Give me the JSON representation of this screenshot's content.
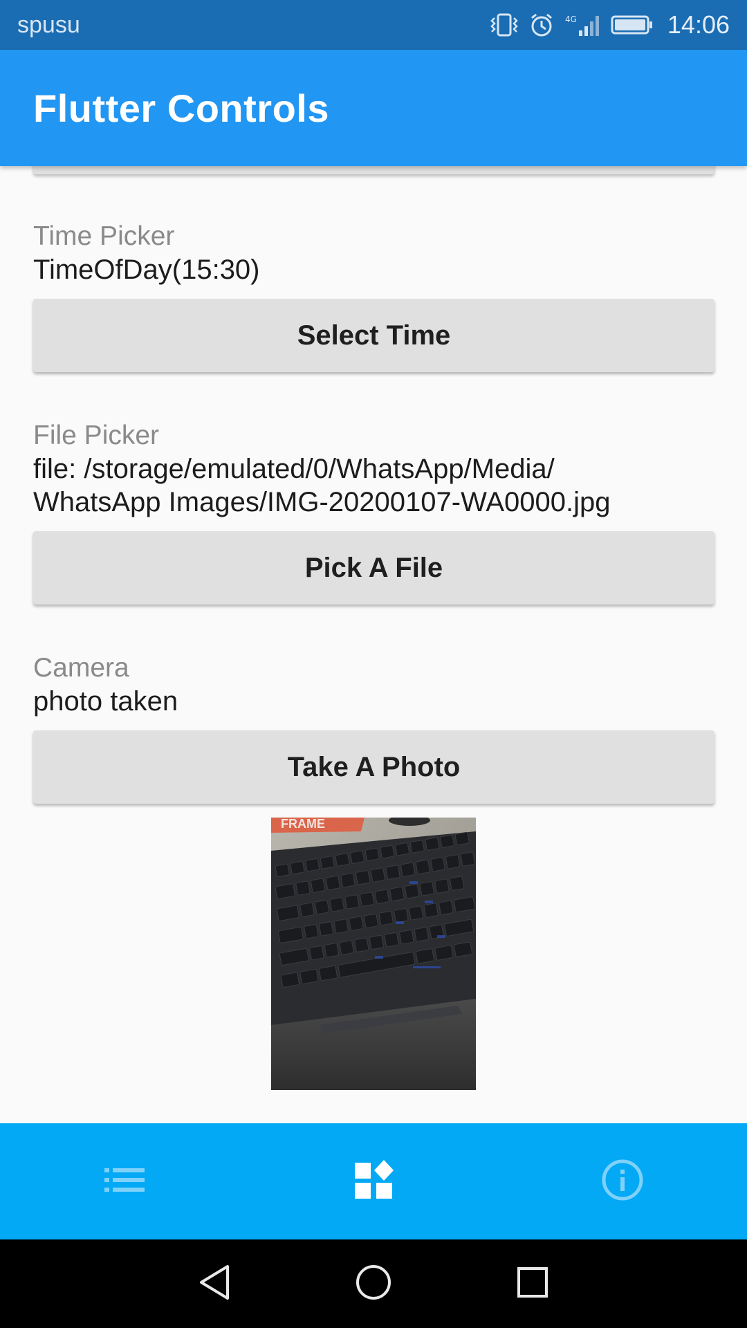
{
  "status_bar": {
    "carrier": "spusu",
    "time": "14:06",
    "icons": [
      "vibrate-icon",
      "alarm-icon",
      "signal-4g-icon",
      "battery-icon"
    ]
  },
  "app_bar": {
    "title": "Flutter Controls"
  },
  "sections": {
    "time_picker": {
      "label": "Time Picker",
      "value": "TimeOfDay(15:30)",
      "button_label": "Select Time"
    },
    "file_picker": {
      "label": "File Picker",
      "value_line1": "file: /storage/emulated/0/WhatsApp/Media/",
      "value_line2": "WhatsApp Images/IMG-20200107-WA0000.jpg",
      "button_label": "Pick A File"
    },
    "camera": {
      "label": "Camera",
      "value": "photo taken",
      "button_label": "Take A Photo"
    }
  },
  "photo": {
    "subject": "keyboard photo",
    "visible_text": "FRAME"
  },
  "bottom_nav": {
    "items": [
      {
        "icon": "list-icon"
      },
      {
        "icon": "widgets-icon",
        "selected": true
      },
      {
        "icon": "info-icon"
      }
    ]
  },
  "system_nav": {
    "items": [
      "back-icon",
      "home-icon",
      "recents-icon"
    ]
  },
  "colors": {
    "status_bar": "#1b6db3",
    "app_bar": "#2196f3",
    "bottom_nav": "#03a9f4",
    "button_bg": "#e0e0e0",
    "background": "#fafafa"
  }
}
